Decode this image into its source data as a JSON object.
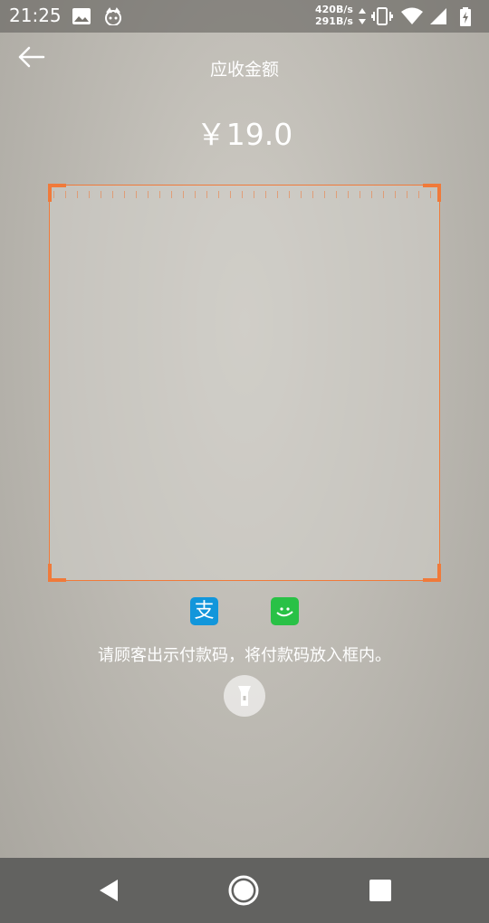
{
  "status_bar": {
    "time": "21:25",
    "net_up": "420B/s",
    "net_down": "291B/s",
    "icons": [
      "image-icon",
      "app-notification-icon",
      "data-arrows-icon",
      "vibrate-icon",
      "wifi-icon",
      "signal-icon",
      "battery-charging-icon"
    ]
  },
  "header": {
    "back_icon": "back-arrow-icon",
    "title": "应收金额"
  },
  "amount": "￥19.0",
  "scanner": {
    "frame_color": "#f07a3a"
  },
  "payment_methods": [
    {
      "name": "alipay-icon",
      "glyph": "支",
      "color": "#1296db"
    },
    {
      "name": "wechat-pay-icon",
      "color": "#29c146"
    }
  ],
  "hint": "请顾客出示付款码，将付款码放入框内。",
  "flashlight_icon": "flashlight-icon",
  "nav_bar": {
    "icons": [
      "back-triangle-icon",
      "home-circle-icon",
      "recents-square-icon"
    ]
  }
}
